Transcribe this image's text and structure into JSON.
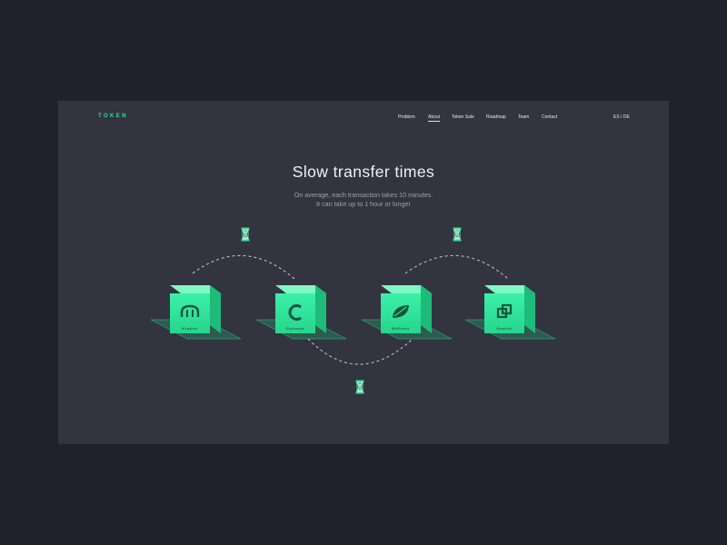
{
  "header": {
    "logo": "TOKEN",
    "nav": [
      "Problem",
      "About",
      "Token Sale",
      "Roadmap",
      "Team",
      "Contact"
    ],
    "active": "About",
    "lang": "ES / DE"
  },
  "hero": {
    "title": "Slow transfer times",
    "line1": "On average, each transaction takes 10 minutes.",
    "line2": "It can take  up to 1 hour or longer"
  },
  "exchanges": [
    {
      "label": "Kraken",
      "icon": "kraken-icon"
    },
    {
      "label": "Coinone",
      "icon": "coinone-icon"
    },
    {
      "label": "Bitfinex",
      "icon": "bitfinex-icon"
    },
    {
      "label": "Gemini",
      "icon": "gemini-icon"
    }
  ],
  "colors": {
    "accent": "#2fe39a",
    "background": "#1f222b",
    "panel": "#32343f"
  }
}
